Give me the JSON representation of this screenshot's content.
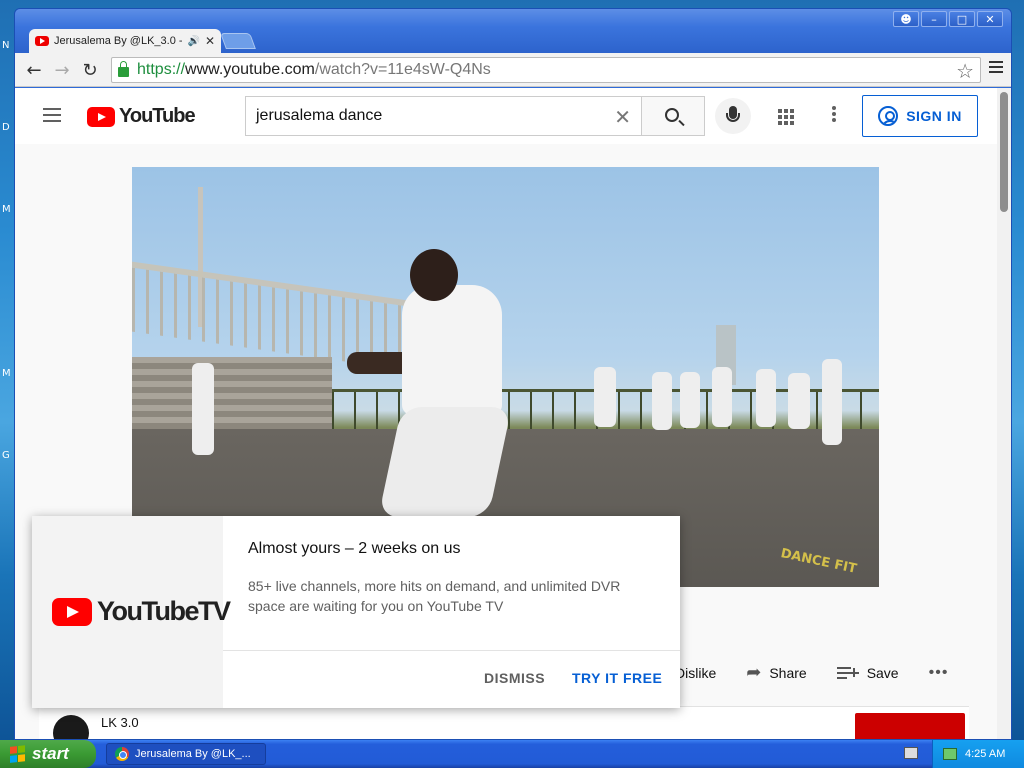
{
  "browser": {
    "tab_title": "Jerusalema By @LK_3.0 -",
    "tab_sound_icon": "speaker-icon",
    "url_scheme": "https://",
    "url_host": "www.youtube.com",
    "url_path": "/watch?v=11e4sW-Q4Ns"
  },
  "youtube": {
    "logo_text": "YouTube",
    "search_query": "jerusalema dance",
    "sign_in_label": "SIGN IN",
    "video_watermark": "DANCE FIT",
    "actions": {
      "dislike_label": "Dislike",
      "share_label": "Share",
      "save_label": "Save"
    },
    "channel_name": "LK 3.0"
  },
  "popup": {
    "logo_text": "YouTubeTV",
    "title": "Almost yours – 2 weeks on us",
    "body": "85+ live channels, more hits on demand, and unlimited DVR space are waiting for you on YouTube TV",
    "dismiss_label": "DISMISS",
    "try_label": "TRY IT FREE"
  },
  "taskbar": {
    "start_label": "start",
    "task_label": "Jerusalema By @LK_...",
    "clock": "4:25 AM"
  },
  "colors": {
    "youtube_red": "#ff0000",
    "link_blue": "#065fd4",
    "xp_blue": "#245edb",
    "start_green": "#3a9a33"
  }
}
